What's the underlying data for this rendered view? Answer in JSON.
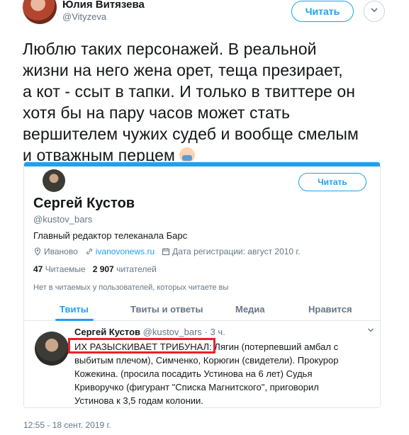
{
  "author": {
    "name": "Юлия Витязева",
    "handle": "@Vityzeva"
  },
  "actions": {
    "follow_label": "Читать"
  },
  "tweet": {
    "lines": [
      "Люблю таких персонажей. В реальной",
      "жизни на него жена орет, теща презирает,",
      "а кот - ссыт в тапки. И только в твиттере он",
      "хотя бы на пару часов может стать",
      "вершителем чужих судеб и вообще смелым",
      "и отважным перцем"
    ],
    "emoji": "facepalm"
  },
  "profile_card": {
    "follow_label": "Читать",
    "name": "Сергей Кустов",
    "handle": "@kustov_bars",
    "bio": "Главный редактор телеканала Барс",
    "location": "Иваново",
    "website": "ivanovonews.ru",
    "joined": "Дата регистрации: август 2010 г.",
    "following_count": "47",
    "following_label": "Читаемые",
    "followers_count": "2 907",
    "followers_label": "читателей",
    "no_followers_note": "Нет в читаемых у пользователей, которых читаете вы",
    "tabs": [
      "Твиты",
      "Твиты и ответы",
      "Медиа",
      "Нравится"
    ],
    "tweet": {
      "name": "Сергей Кустов",
      "handle_time": "@kustov_bars · 3 ч.",
      "lines": [
        "ИХ РАЗЫСКИВАЕТ ТРИБУНАЛ: Лягин (потерпевший амбал с",
        "выбитым плечом), Симченко, Корюгин (свидетели). Прокурор",
        "Кожекина. (просила посадить Устинова на 6 лет) Судья",
        "Криворучко (фигурант \"Списка Магнитского\", приговорил",
        "Устинова к 3,5 годам колонии."
      ]
    },
    "accent_color": "#1da1f2",
    "highlight_color": "#e8222c"
  },
  "timestamp": "12:55 - 18 сент. 2019 г."
}
